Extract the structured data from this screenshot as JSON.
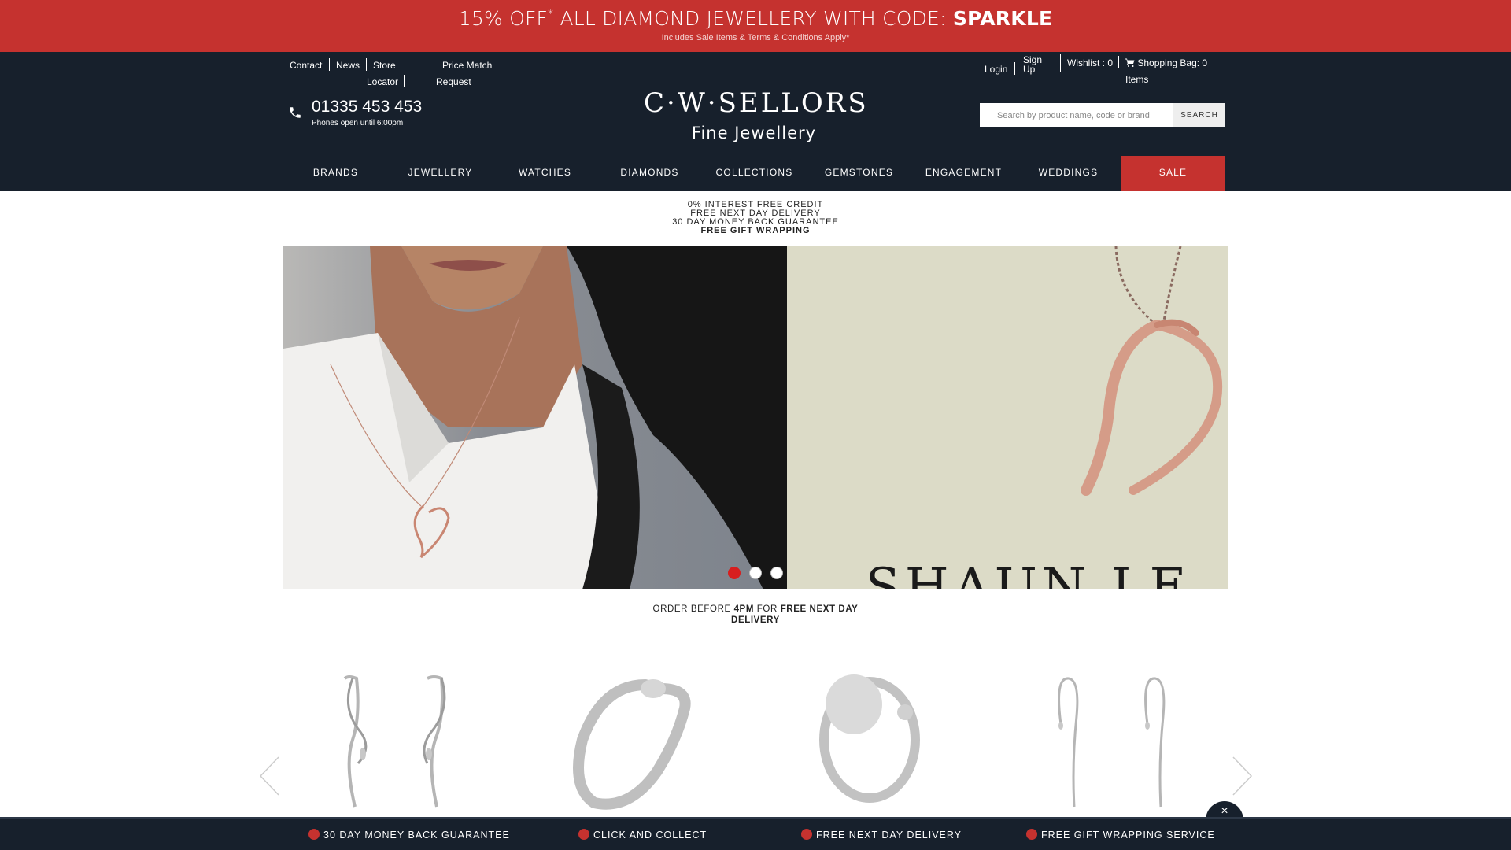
{
  "promo": {
    "main_prefix": "15% OFF",
    "asterisk": "*",
    "main_middle": " ALL DIAMOND JEWELLERY WITH CODE: ",
    "code": "SPARKLE",
    "sub": "Includes Sale Items & Terms & Conditions Apply*"
  },
  "header": {
    "links": {
      "contact": "Contact",
      "news": "News",
      "store": "Store",
      "locator": "Locator",
      "price_match": "Price Match",
      "request": "Request"
    },
    "phone": "01335 453 453",
    "phone_hours": "Phones open until 6:00pm",
    "logo_brand": "C·W·SELLORS",
    "logo_tag": "Fine Jewellery",
    "account": {
      "login": "Login",
      "sign": "Sign",
      "up": "Up",
      "wishlist": "Wishlist : 0",
      "bag": "Shopping Bag: 0",
      "items": "Items"
    },
    "search_placeholder": "Search by product name, code or brand",
    "search_button": "SEARCH"
  },
  "nav": [
    "BRANDS",
    "JEWELLERY",
    "WATCHES",
    "DIAMONDS",
    "COLLECTIONS",
    "GEMSTONES",
    "ENGAGEMENT",
    "WEDDINGS",
    "SALE"
  ],
  "benefits": [
    "0% INTEREST FREE CREDIT",
    "FREE NEXT DAY DELIVERY",
    "30 DAY MONEY BACK GUARANTEE",
    "FREE GIFT WRAPPING"
  ],
  "hero": {
    "brand_text": "SHAUN LE",
    "slides_total": 3,
    "active_slide": 1
  },
  "order_note": {
    "p1": "ORDER BEFORE ",
    "time": "4PM",
    "p2": " FOR ",
    "p3": "FREE NEXT DAY",
    "p4": "DELIVERY"
  },
  "usps": [
    "30 DAY MONEY BACK GUARANTEE",
    "CLICK AND COLLECT",
    "FREE NEXT DAY DELIVERY",
    "FREE GIFT WRAPPING SERVICE"
  ],
  "close_label": "×",
  "colors": {
    "brand_red": "#c5322f",
    "navy": "#17202c"
  }
}
